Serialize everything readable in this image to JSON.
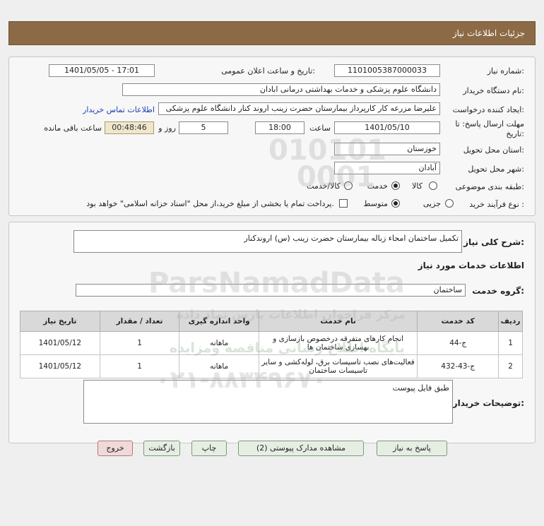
{
  "header": {
    "title": "جزئیات اطلاعات نیاز"
  },
  "form": {
    "need_number_label": "شماره نیاز:",
    "need_number": "1101005387000033",
    "announce_label": "تاریخ و ساعت اعلان عمومی:",
    "announce_value": "1401/05/05 - 17:01",
    "buyer_label": "نام دستگاه خریدار:",
    "buyer_value": "دانشگاه علوم پزشکی و خدمات بهداشتی  درمانی ابادان",
    "creator_label": "ایجاد کننده درخواست:",
    "creator_value": "علیرضا مزرعه کار کارپرداز بیمارستان حضرت زینب اروند کنار دانشگاه علوم پزشکی",
    "contact_link": "اطلاعات تماس خریدار",
    "deadline_label_1": "مهلت ارسال پاسخ: تا",
    "deadline_label_2": "تاریخ:",
    "deadline_date": "1401/05/10",
    "time_label": "ساعت",
    "deadline_time": "18:00",
    "days_value": "5",
    "days_label": "روز و",
    "remaining_time": "00:48:46",
    "remaining_label": "ساعت باقی مانده",
    "province_label": "استان محل تحویل:",
    "province_value": "خوزستان",
    "city_label": "شهر محل تحویل:",
    "city_value": "آبادان",
    "category_label": "طبقه بندی موضوعی:",
    "category_options": [
      "کالا",
      "خدمت",
      "کالا/خدمت"
    ],
    "category_selected": "خدمت",
    "process_label": "نوع فرآیند خرید :",
    "process_options": [
      "جزیی",
      "متوسط"
    ],
    "process_selected": "متوسط",
    "payment_note": "پرداخت تمام یا بخشی از مبلغ خرید،از محل \"اسناد خزانه اسلامی\" خواهد بود."
  },
  "summary": {
    "label": "شرح کلی نیاز:",
    "value": "تکمیل ساختمان امحاء زباله بیمارستان حضرت زینب (س) اروندکنار"
  },
  "services": {
    "title": "اطلاعات خدمات مورد نیاز",
    "group_label": "گروه خدمت:",
    "group_value": "ساختمان",
    "columns": [
      "ردیف",
      "کد خدمت",
      "نام خدمت",
      "واحد اندازه گیری",
      "تعداد / مقدار",
      "تاریخ نیاز"
    ],
    "rows": [
      {
        "row": "1",
        "code": "ج-44",
        "name": "انجام کارهای متفرقه درخصوص بازسازی و بهسازی ساختمان ها",
        "unit": "ماهانه",
        "qty": "1",
        "date": "1401/05/12"
      },
      {
        "row": "2",
        "code": "ج-43-432",
        "name": "فعالیت‌های نصب تاسیسات برق، لوله‌کشی و سایر تاسیسات ساختمان",
        "unit": "ماهانه",
        "qty": "1",
        "date": "1401/05/12"
      }
    ]
  },
  "buyer_notes": {
    "label": "توضیحات خریدار:",
    "value": "طبق فایل پیوست"
  },
  "buttons": {
    "reply": "پاسخ به نیاز",
    "view_docs": "مشاهده مدارک پیوستی (2)",
    "print": "چاپ",
    "back": "بازگشت",
    "exit": "خروج"
  },
  "watermark": {
    "digits_1": "010101",
    "digits_2": "0001",
    "brand": "ParsNamadData",
    "line_1": "مرکز فراخوان اطلاعات پارس نماد داده",
    "line_2": "پایگاه اطلاع رسانی مناقصه ومزایده",
    "phone": "۰۲۱-۸۸۳۴۹۶۷۰"
  },
  "colors": {
    "title_bar": "#8c6a45",
    "link": "#1a43b0",
    "button_exit": "#f2d9d9"
  }
}
